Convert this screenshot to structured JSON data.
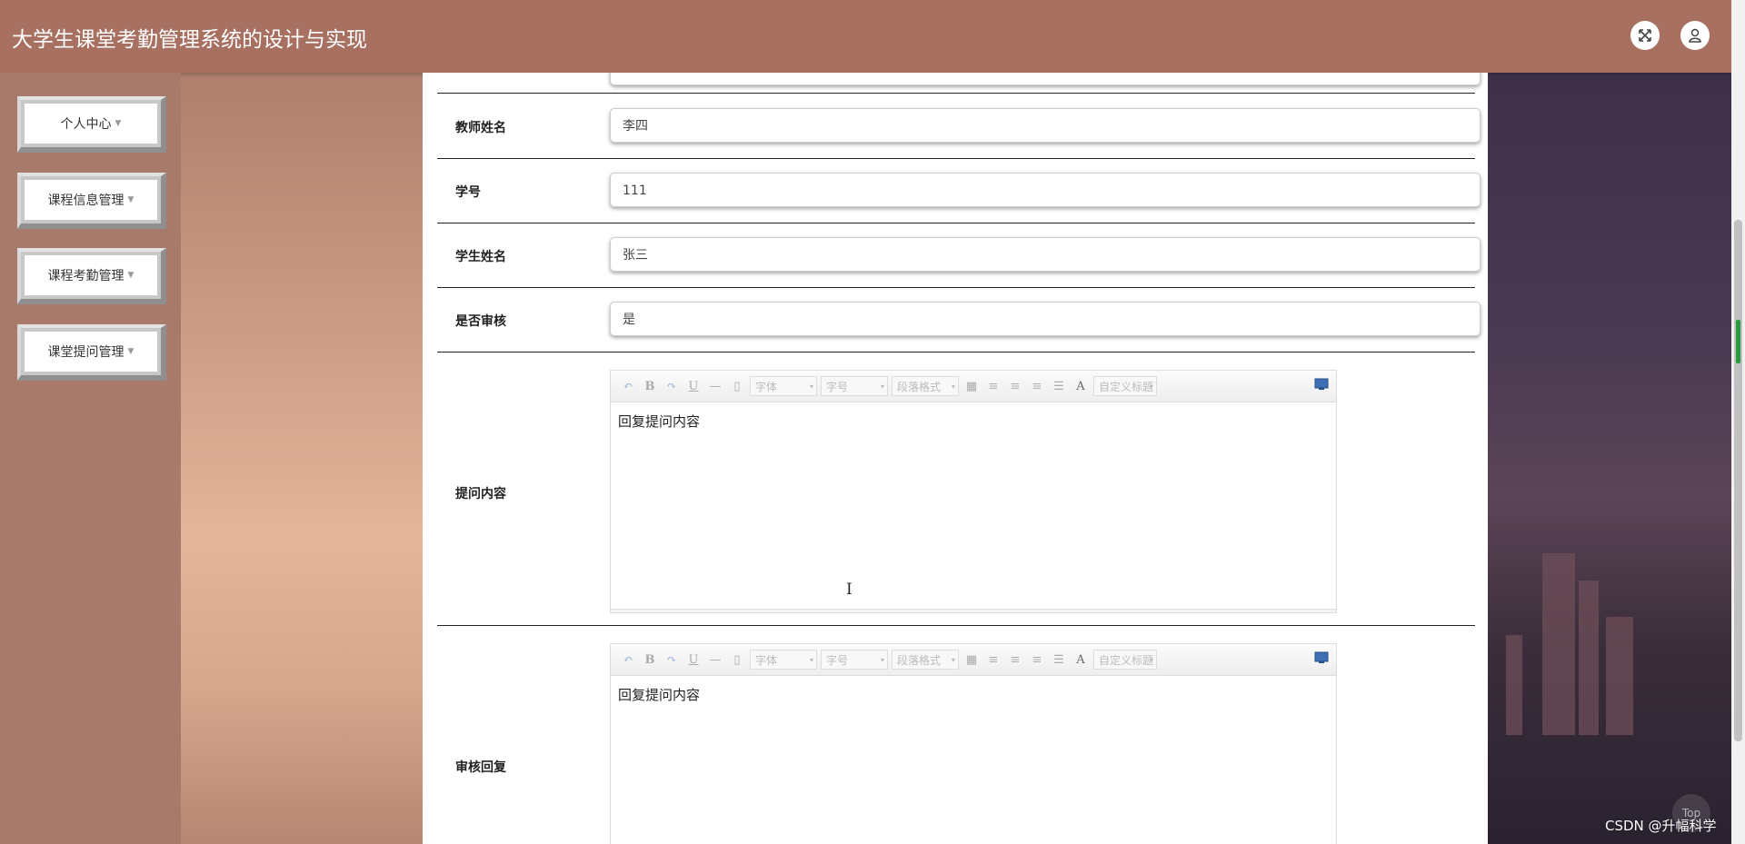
{
  "header": {
    "title": "大学生课堂考勤管理系统的设计与实现",
    "fullscreen_icon": "expand-icon",
    "user_icon": "user-icon"
  },
  "sidebar": {
    "items": [
      {
        "label": "个人中心"
      },
      {
        "label": "课程信息管理"
      },
      {
        "label": "课程考勤管理"
      },
      {
        "label": "课堂提问管理"
      }
    ]
  },
  "form": {
    "fields": [
      {
        "label": "教师姓名",
        "value": "李四"
      },
      {
        "label": "学号",
        "value": "111"
      },
      {
        "label": "学生姓名",
        "value": "张三"
      },
      {
        "label": "是否审核",
        "value": "是"
      }
    ],
    "editors": [
      {
        "label": "提问内容",
        "content": "回复提问内容"
      },
      {
        "label": "审核回复",
        "content": "回复提问内容"
      }
    ]
  },
  "toolbar": {
    "font": "字体",
    "size": "字号",
    "paragraph": "段落格式",
    "custom_title": "自定义标题",
    "bold": "B",
    "underline": "U",
    "font_color": "A"
  },
  "watermark": "CSDN @升幅科学",
  "top_button": "Top"
}
